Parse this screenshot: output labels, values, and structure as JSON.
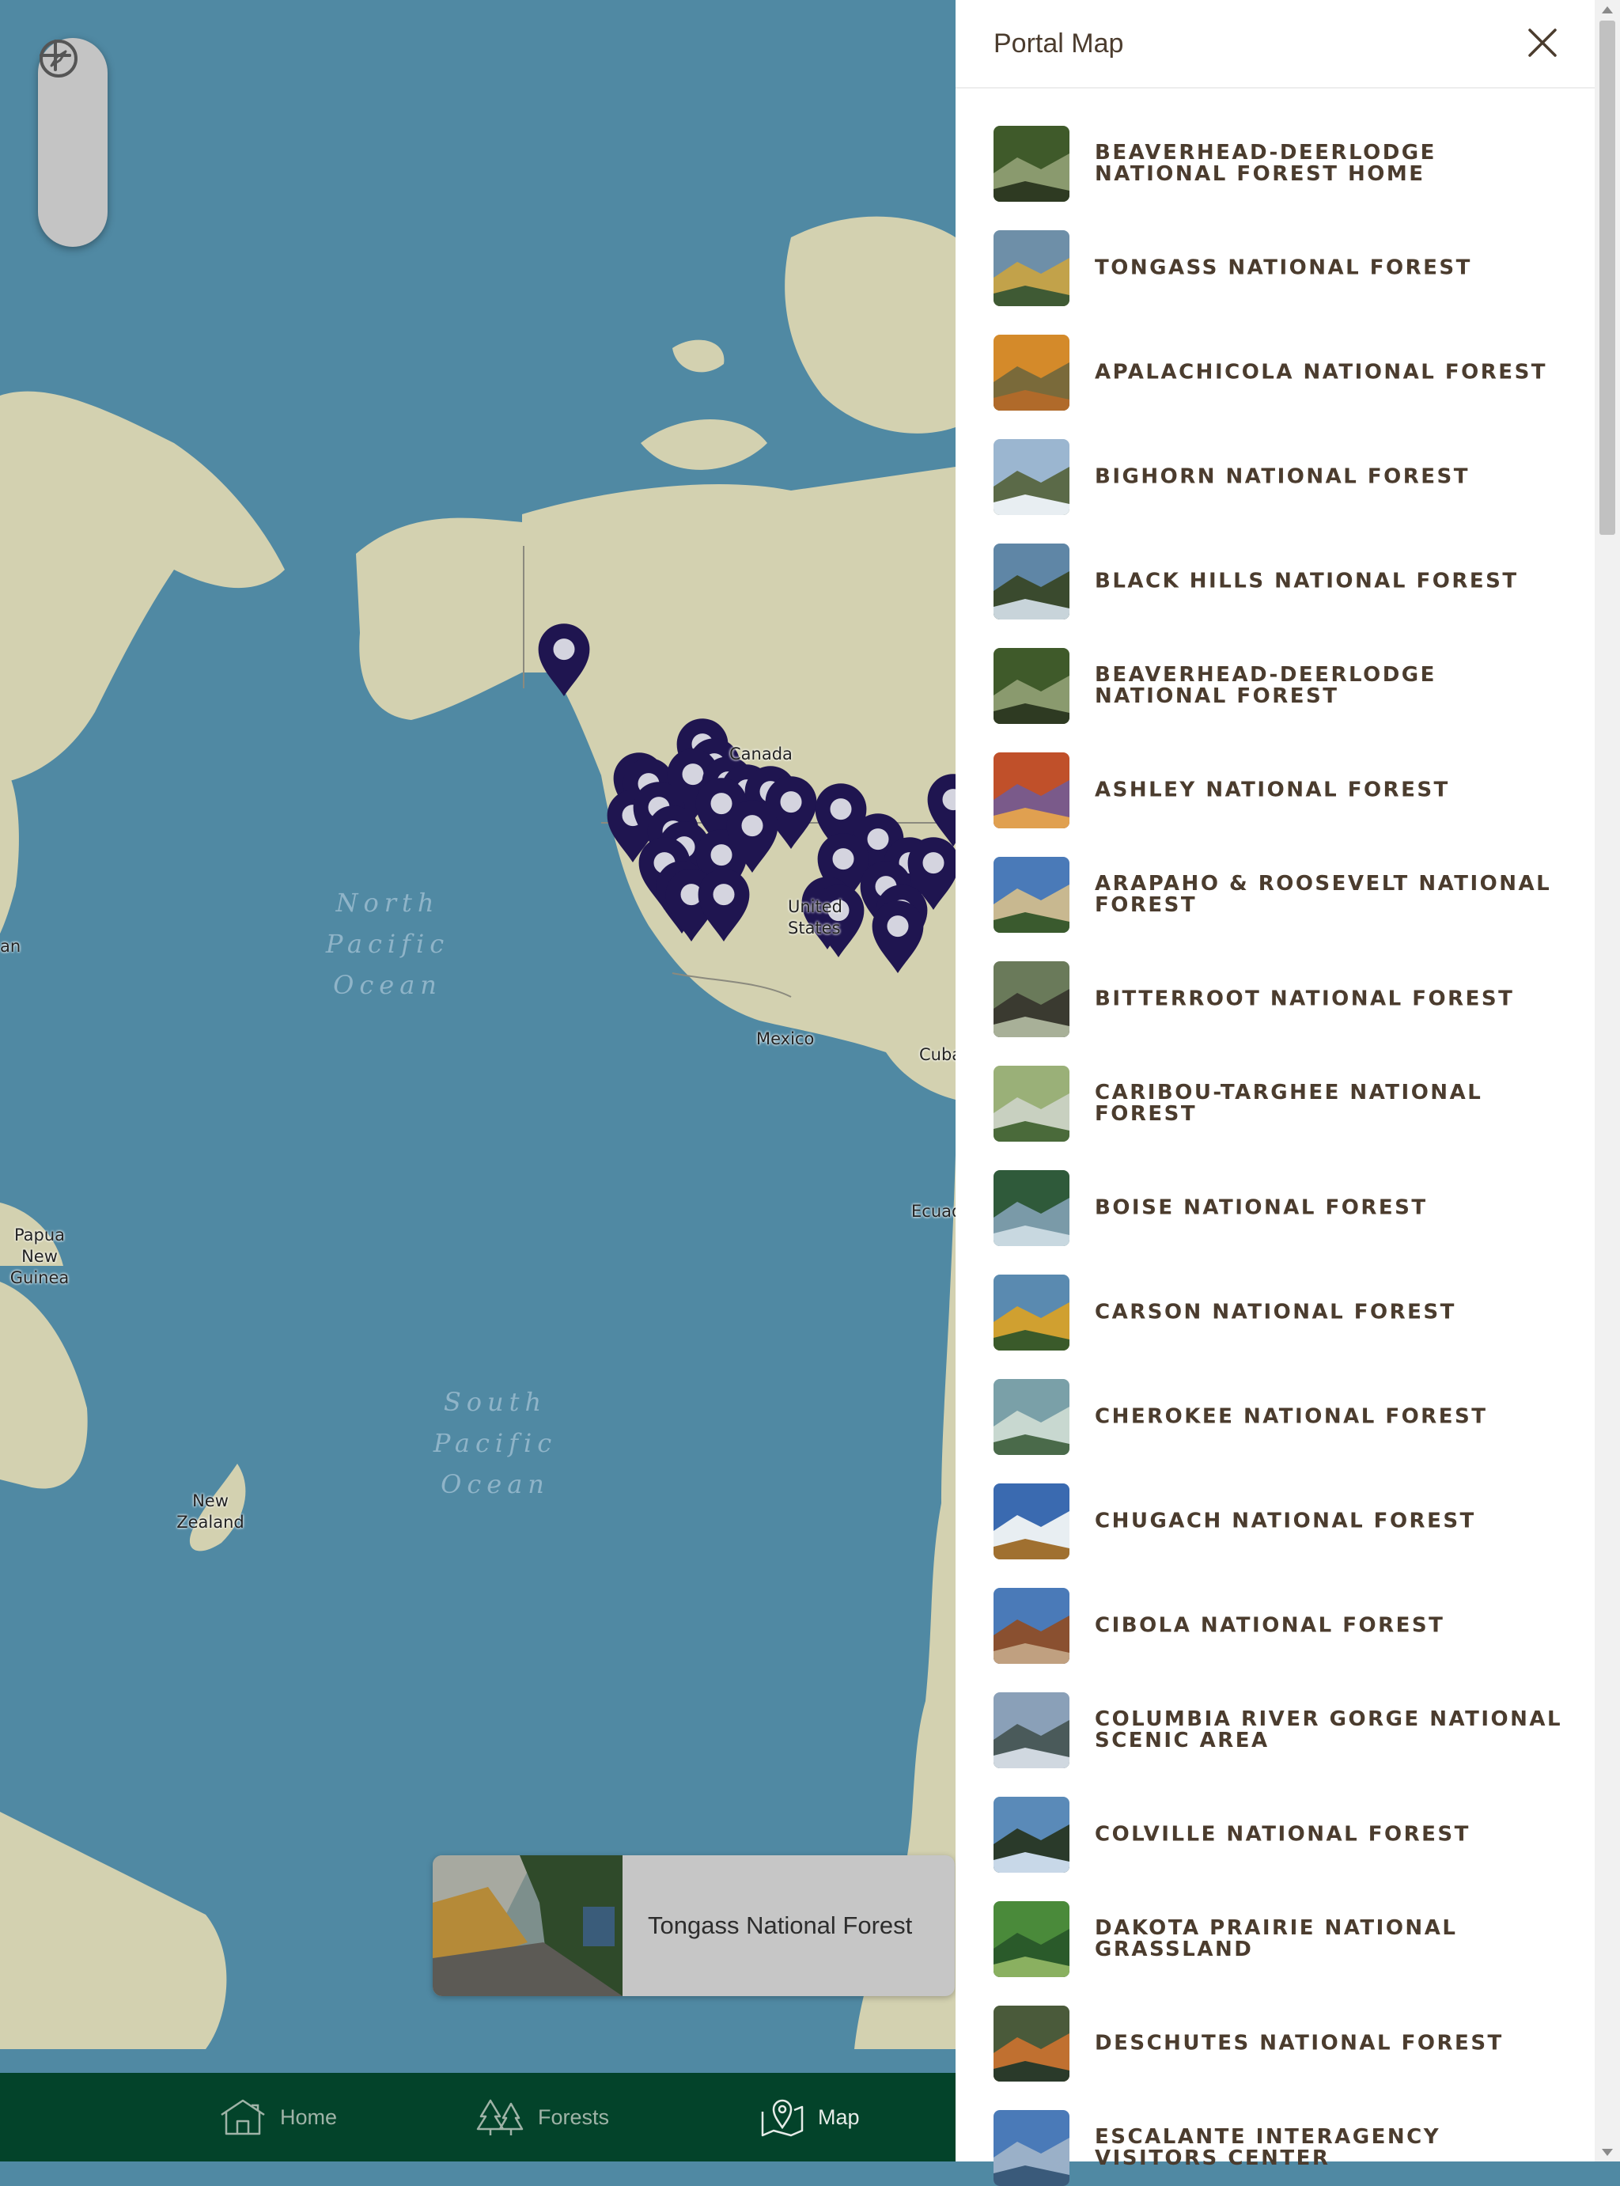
{
  "map": {
    "place_labels": {
      "canada": "Canada",
      "united_states_line1": "United",
      "united_states_line2": "States",
      "mexico": "Mexico",
      "cuba": "Cuba",
      "ecuador": "Ecuador",
      "papua_new_guinea_line1": "Papua New",
      "papua_new_guinea_line2": "Guinea",
      "new_zealand_line1": "New",
      "new_zealand_line2": "Zealand",
      "japan_fragment": "an"
    },
    "ocean_labels": {
      "north_pacific": [
        "North",
        "Pacific",
        "Ocean"
      ],
      "south_pacific": [
        "South",
        "Pacific",
        "Ocean"
      ]
    },
    "marker_color": "#1f1550",
    "zoom_controls": {
      "zoom_in_icon": "plus-icon",
      "zoom_out_icon": "minus-icon",
      "compass_icon": "compass-icon"
    },
    "preview_card": {
      "title": "Tongass National Forest"
    }
  },
  "bottom_nav": {
    "items": [
      {
        "label": "Home",
        "icon": "home-icon"
      },
      {
        "label": "Forests",
        "icon": "trees-icon"
      },
      {
        "label": "Map",
        "icon": "map-pin-icon",
        "active": true
      }
    ],
    "background_color": "#03432a"
  },
  "panel": {
    "title": "Portal Map",
    "close_icon": "close-icon",
    "text_color": "#4b3c2e",
    "items": [
      {
        "label": "BEAVERHEAD-DEERLODGE NATIONAL FOREST HOME"
      },
      {
        "label": "TONGASS NATIONAL FOREST"
      },
      {
        "label": "APALACHICOLA NATIONAL FOREST"
      },
      {
        "label": "BIGHORN NATIONAL FOREST"
      },
      {
        "label": "BLACK HILLS NATIONAL FOREST"
      },
      {
        "label": "BEAVERHEAD-DEERLODGE NATIONAL FOREST"
      },
      {
        "label": "ASHLEY NATIONAL FOREST"
      },
      {
        "label": "ARAPAHO & ROOSEVELT NATIONAL FOREST"
      },
      {
        "label": "BITTERROOT NATIONAL FOREST"
      },
      {
        "label": "CARIBOU-TARGHEE NATIONAL FOREST"
      },
      {
        "label": "BOISE NATIONAL FOREST"
      },
      {
        "label": "CARSON NATIONAL FOREST"
      },
      {
        "label": "CHEROKEE NATIONAL FOREST"
      },
      {
        "label": "CHUGACH NATIONAL FOREST"
      },
      {
        "label": "CIBOLA NATIONAL FOREST"
      },
      {
        "label": "COLUMBIA RIVER GORGE NATIONAL SCENIC AREA"
      },
      {
        "label": "COLVILLE NATIONAL FOREST"
      },
      {
        "label": "DAKOTA PRAIRIE NATIONAL GRASSLAND"
      },
      {
        "label": "DESCHUTES NATIONAL FOREST"
      },
      {
        "label": "ESCALANTE INTERAGENCY VISITORS CENTER"
      }
    ]
  }
}
